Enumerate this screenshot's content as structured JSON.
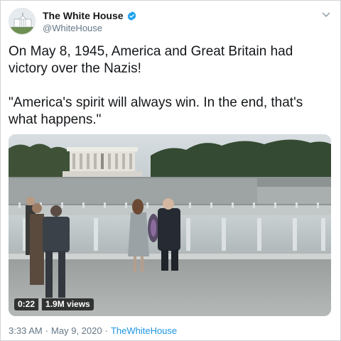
{
  "account": {
    "display_name": "The White House",
    "handle": "@WhiteHouse",
    "verified": true,
    "avatar_icon": "white-house-building-icon"
  },
  "tweet": {
    "text": "On May 8, 1945, America and Great Britain had victory over the Nazis!\n\n\"America's spirit will always win. In the end, that's what happens.\""
  },
  "media": {
    "type": "video",
    "duration": "0:22",
    "views": "1.9M views"
  },
  "footer": {
    "time": "3:33 AM",
    "separator1": "·",
    "date": "May 9, 2020",
    "separator2": "·",
    "source": "TheWhiteHouse"
  },
  "icons": {
    "verified": "verified-badge-icon",
    "menu": "chevron-down-icon"
  },
  "colors": {
    "accent": "#1da1f2",
    "link": "#1b95e0",
    "secondary_text": "#657786"
  }
}
